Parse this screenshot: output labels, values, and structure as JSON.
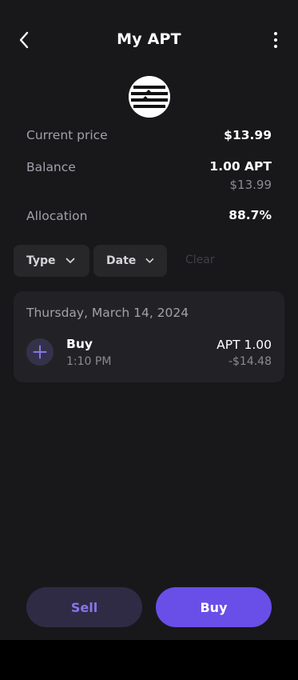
{
  "header": {
    "title": "My APT",
    "back_icon": "chevron-left-icon",
    "more_icon": "more-vertical-icon"
  },
  "token": {
    "logo_icon": "aptos-logo"
  },
  "info": {
    "current_price_label": "Current price",
    "current_price_value": "$13.99",
    "balance_label": "Balance",
    "balance_value": "1.00 APT",
    "balance_fiat": "$13.99",
    "allocation_label": "Allocation",
    "allocation_value": "88.7%"
  },
  "filters": {
    "type_label": "Type",
    "date_label": "Date",
    "clear_label": "Clear"
  },
  "transactions": {
    "date_heading": "Thursday, March 14, 2024",
    "items": [
      {
        "type": "Buy",
        "time": "1:10 PM",
        "amount": "APT 1.00",
        "value": "-$14.48",
        "icon": "plus-icon"
      }
    ]
  },
  "actions": {
    "sell_label": "Sell",
    "buy_label": "Buy"
  },
  "colors": {
    "background": "#18181b",
    "accent": "#6a4ee8",
    "sell_bg": "#2f2b45",
    "sell_text": "#8b74e8",
    "card": "#222226"
  }
}
